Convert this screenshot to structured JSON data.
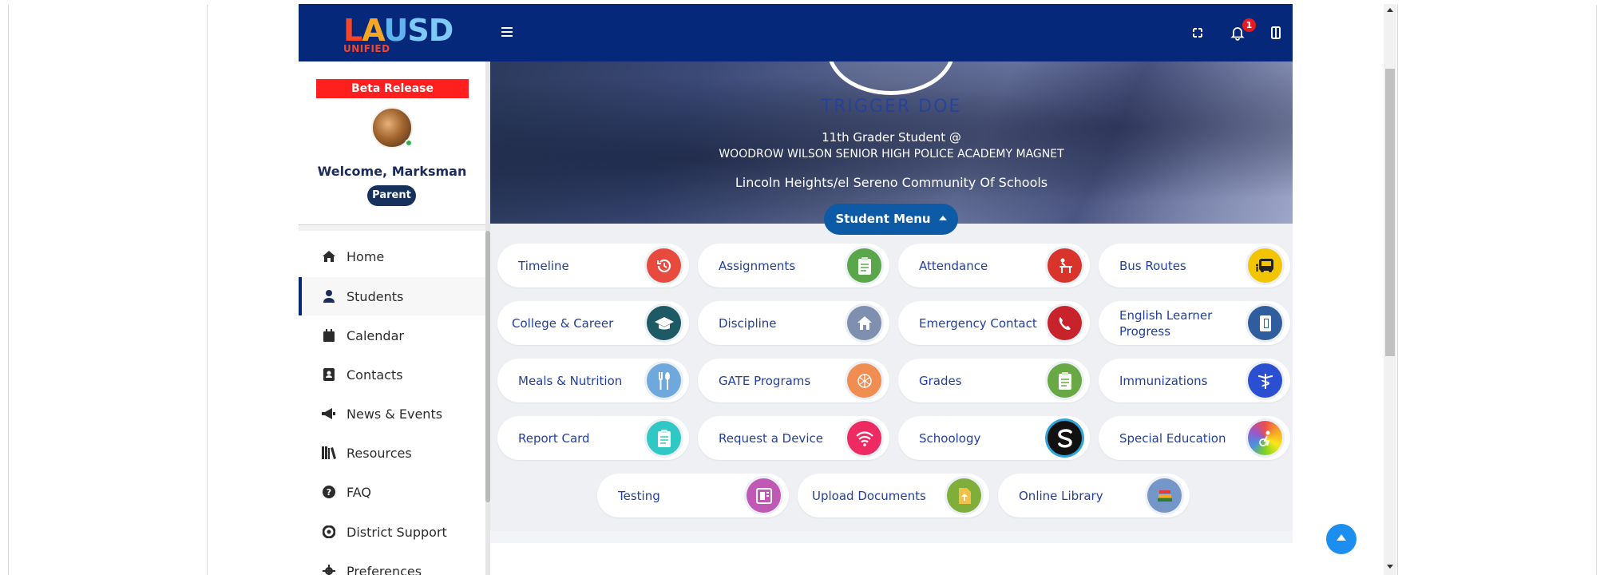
{
  "header": {
    "logo_text": [
      "L",
      "A",
      "U",
      "SD"
    ],
    "logo_sub": "UNIFIED",
    "notification_count": "1"
  },
  "sidebar": {
    "beta_label": "Beta Release",
    "welcome": "Welcome, Marksman",
    "role": "Parent",
    "items": [
      {
        "label": "Home",
        "icon": "home-icon"
      },
      {
        "label": "Students",
        "icon": "user-icon",
        "active": true
      },
      {
        "label": "Calendar",
        "icon": "calendar-icon"
      },
      {
        "label": "Contacts",
        "icon": "contact-card-icon"
      },
      {
        "label": "News & Events",
        "icon": "megaphone-icon"
      },
      {
        "label": "Resources",
        "icon": "books-icon"
      },
      {
        "label": "FAQ",
        "icon": "question-icon"
      },
      {
        "label": "District Support",
        "icon": "lifebuoy-icon"
      },
      {
        "label": "Preferences",
        "icon": "gear-icon"
      }
    ]
  },
  "hero": {
    "student_name": "TRIGGER DOE",
    "grade_line": "11th Grader Student @",
    "school": "WOODROW WILSON SENIOR HIGH POLICE ACADEMY MAGNET",
    "community": "Lincoln Heights/el Sereno Community Of Schools"
  },
  "student_menu": {
    "button_label": "Student Menu",
    "tiles": [
      {
        "label": "Timeline",
        "icon": "history-icon",
        "color": "#e84a3d"
      },
      {
        "label": "Assignments",
        "icon": "clipboard-icon",
        "color": "#5aa64a"
      },
      {
        "label": "Attendance",
        "icon": "desk-icon",
        "color": "#d8342b"
      },
      {
        "label": "Bus Routes",
        "icon": "bus-icon",
        "color": "#f2c500"
      },
      {
        "label": "College & Career",
        "icon": "graduation-cap-icon",
        "color": "#1d5a66"
      },
      {
        "label": "Discipline",
        "icon": "school-house-icon",
        "color": "#7e8fb0"
      },
      {
        "label": "Emergency Contact",
        "icon": "phone-icon",
        "color": "#c8222a"
      },
      {
        "label": "English Learner Progress",
        "icon": "book-icon",
        "color": "#2f5d9e"
      },
      {
        "label": "Meals & Nutrition",
        "icon": "fork-spoon-icon",
        "color": "#6fa8dc"
      },
      {
        "label": "GATE Programs",
        "icon": "brain-icon",
        "color": "#f08d53"
      },
      {
        "label": "Grades",
        "icon": "clipboard-icon",
        "color": "#68a945"
      },
      {
        "label": "Immunizations",
        "icon": "caduceus-icon",
        "color": "#2a4fd1"
      },
      {
        "label": "Report Card",
        "icon": "clipboard-icon",
        "color": "#2fc8c4"
      },
      {
        "label": "Request a Device",
        "icon": "wifi-icon",
        "color": "#ee2a62"
      },
      {
        "label": "Schoology",
        "icon": "schoology-icon",
        "color": "#111111"
      },
      {
        "label": "Special Education",
        "icon": "special-ed-icon",
        "color": "#9b57c9"
      },
      {
        "label": "Testing",
        "icon": "tablet-icon",
        "color": "#c058b6"
      },
      {
        "label": "Upload Documents",
        "icon": "upload-document-icon",
        "color": "#7fae3b"
      },
      {
        "label": "Online Library",
        "icon": "library-books-icon",
        "color": "#7596c8"
      }
    ]
  }
}
